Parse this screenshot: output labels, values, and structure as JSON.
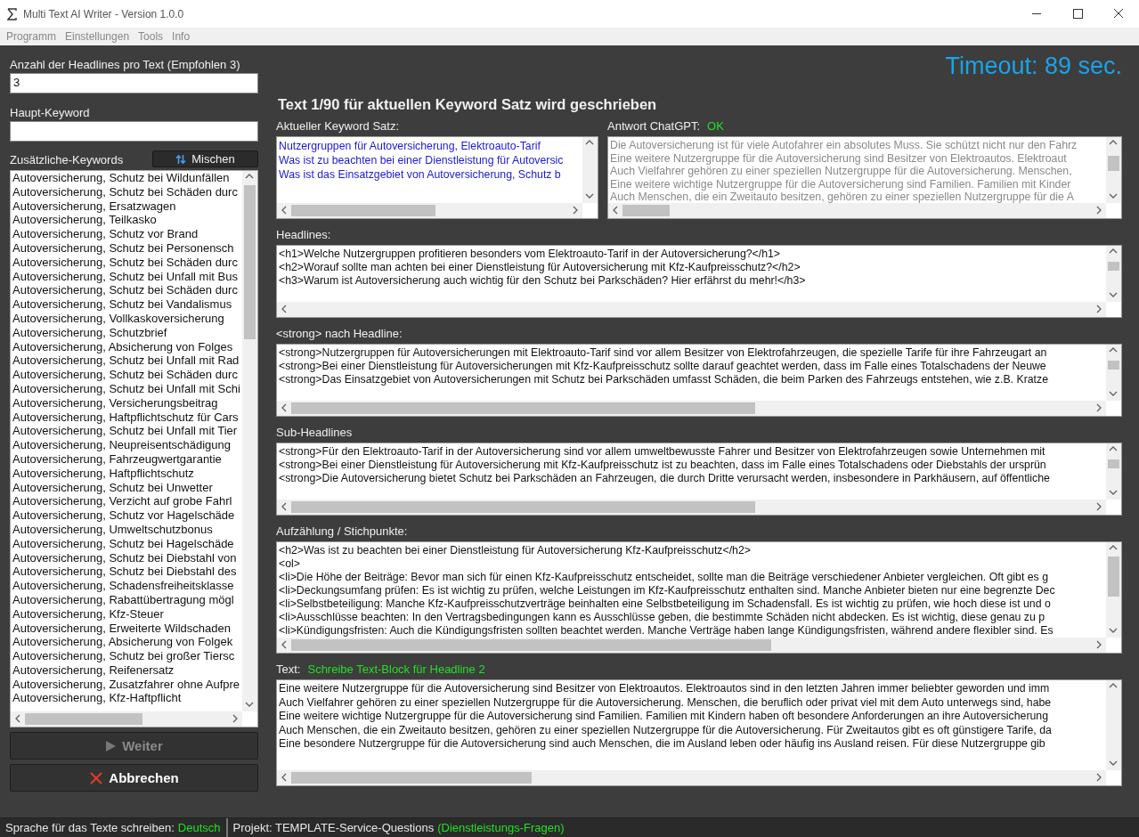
{
  "window": {
    "title": "Multi Text AI Writer - Version 1.0.0"
  },
  "menu": [
    "Programm",
    "Einstellungen",
    "Tools",
    "Info"
  ],
  "left": {
    "headline_count": {
      "label": "Anzahl der Headlines pro Text (Empfohlen 3)",
      "value": "3"
    },
    "main_keyword": {
      "label": "Haupt-Keyword"
    },
    "extra_keywords": {
      "label": "Zusätzliche-Keywords",
      "shuffle_button": "Mischen",
      "items": [
        "Autoversicherung, Schutz bei Wildunfällen",
        "Autoversicherung, Schutz bei Schäden durc",
        "Autoversicherung, Ersatzwagen",
        "Autoversicherung, Teilkasko",
        "Autoversicherung, Schutz vor Brand",
        "Autoversicherung, Schutz bei Personensch",
        "Autoversicherung, Schutz bei Schäden durc",
        "Autoversicherung, Schutz bei Unfall mit Bus",
        "Autoversicherung, Schutz bei Schäden durc",
        "Autoversicherung, Schutz bei Vandalismus",
        "Autoversicherung, Vollkaskoversicherung",
        "Autoversicherung, Schutzbrief",
        "Autoversicherung, Absicherung von Folges",
        "Autoversicherung, Schutz bei Unfall mit Rad",
        "Autoversicherung, Schutz bei Schäden durc",
        "Autoversicherung, Schutz bei Unfall mit Schi",
        "Autoversicherung, Versicherungsbeitrag",
        "Autoversicherung, Haftpflichtschutz für Cars",
        "Autoversicherung, Schutz bei Unfall mit Tier",
        "Autoversicherung, Neupreisentschädigung",
        "Autoversicherung, Fahrzeugwertgarantie",
        "Autoversicherung, Haftpflichtschutz",
        "Autoversicherung, Schutz bei Unwetter",
        "Autoversicherung, Verzicht auf grobe Fahrl",
        "Autoversicherung, Schutz vor Hagelschäde",
        "Autoversicherung, Umweltschutzbonus",
        "Autoversicherung, Schutz bei Hagelschäde",
        "Autoversicherung, Schutz bei Diebstahl von",
        "Autoversicherung, Schutz bei Diebstahl des",
        "Autoversicherung, Schadensfreiheitsklasse",
        "Autoversicherung, Rabattübertragung mögl",
        "Autoversicherung, Kfz-Steuer",
        "Autoversicherung, Erweiterte Wildschaden",
        "Autoversicherung, Absicherung von Folgek",
        "Autoversicherung, Schutz bei großer Tiersc",
        "Autoversicherung, Reifenersatz",
        "Autoversicherung, Zusatzfahrer ohne Aufpre",
        "Autoversicherung, Kfz-Haftpflicht"
      ]
    },
    "buttons": [
      {
        "label": "Weiter",
        "kind": "next",
        "disabled": true
      },
      {
        "label": "Abbrechen",
        "kind": "cancel",
        "disabled": false
      }
    ]
  },
  "right": {
    "timeout": "Timeout: 89 sec.",
    "heading": "Text 1/90 für aktuellen Keyword Satz wird geschrieben",
    "keyword_set": {
      "label": "Aktueller Keyword Satz:",
      "lines": [
        "Nutzergruppen für Autoversicherung, Elektroauto-Tarif",
        "Was ist zu beachten bei einer Dienstleistung für Autoversic",
        "Was ist das Einsatzgebiet von Autoversicherung, Schutz b"
      ]
    },
    "chatgpt": {
      "label": "Antwort ChatGPT:",
      "status": "OK",
      "lines": [
        "Die Autoversicherung ist für viele Autofahrer ein absolutes Muss. Sie schützt nicht nur den Fahrz",
        "Eine weitere Nutzergruppe für die Autoversicherung sind Besitzer von Elektroautos. Elektroaut",
        "Auch Vielfahrer gehören zu einer speziellen Nutzergruppe für die Autoversicherung. Menschen,",
        "Eine weitere wichtige Nutzergruppe für die Autoversicherung sind Familien. Familien mit Kinder",
        "Auch Menschen, die ein Zweitauto besitzen, gehören zu einer speziellen Nutzergruppe für die A"
      ]
    },
    "headlines": {
      "label": "Headlines:",
      "lines": [
        "<h1>Welche Nutzergruppen profitieren besonders vom Elektroauto-Tarif in der Autoversicherung?</h1>",
        "<h2>Worauf sollte man achten bei einer Dienstleistung für Autoversicherung mit Kfz-Kaufpreisschutz?</h2>",
        "<h3>Warum ist Autoversicherung auch wichtig für den Schutz bei Parkschäden? Hier erfährst du mehr!</h3>"
      ]
    },
    "strong": {
      "label": "<strong> nach Headline:",
      "lines": [
        "<strong>Nutzergruppen für Autoversicherungen mit Elektroauto-Tarif sind vor allem Besitzer von Elektrofahrzeugen, die spezielle Tarife für ihre Fahrzeugart an",
        "<strong>Bei einer Dienstleistung für Autoversicherungen mit Kfz-Kaufpreisschutz sollte darauf geachtet werden, dass im Falle eines Totalschadens der Neuwe",
        "<strong>Das Einsatzgebiet von Autoversicherungen mit Schutz bei Parkschäden umfasst Schäden, die beim Parken des Fahrzeugs entstehen, wie z.B. Kratze"
      ]
    },
    "sub_headlines": {
      "label": "Sub-Headlines",
      "lines": [
        "<strong>Für den Elektroauto-Tarif in der Autoversicherung sind vor allem umweltbewusste Fahrer und Besitzer von Elektrofahrzeugen sowie Unternehmen mit",
        "<strong>Bei einer Dienstleistung für Autoversicherung mit Kfz-Kaufpreisschutz ist zu beachten, dass im Falle eines Totalschadens oder Diebstahls der ursprün",
        "<strong>Die Autoversicherung bietet Schutz bei Parkschäden an Fahrzeugen, die durch Dritte verursacht werden, insbesondere in Parkhäusern, auf öffentliche"
      ]
    },
    "bullets": {
      "label": "Aufzählung / Stichpunkte:",
      "lines": [
        "<h2>Was ist zu beachten bei einer Dienstleistung für Autoversicherung Kfz-Kaufpreisschutz</h2>",
        "<ol>",
        "<li>Die Höhe der Beiträge: Bevor man sich für einen Kfz-Kaufpreisschutz entscheidet, sollte man die Beiträge verschiedener Anbieter vergleichen. Oft gibt es g",
        "<li>Deckungsumfang prüfen: Es ist wichtig zu prüfen, welche Leistungen im Kfz-Kaufpreisschutz enthalten sind. Manche Anbieter bieten nur eine begrenzte Dec",
        "<li>Selbstbeteiligung: Manche Kfz-Kaufpreisschutzverträge beinhalten eine Selbstbeteiligung im Schadensfall. Es ist wichtig zu prüfen, wie hoch diese ist und o",
        "<li>Ausschlüsse beachten: In den Vertragsbedingungen kann es Ausschlüsse geben, die bestimmte Schäden nicht abdecken. Es ist wichtig, diese genau zu p",
        "<li>Kündigungsfristen: Auch die Kündigungsfristen sollten beachtet werden. Manche Verträge haben lange Kündigungsfristen, während andere flexibler sind. Es"
      ]
    },
    "text": {
      "label": "Text:",
      "status": "Schreibe Text-Block für Headline 2",
      "lines": [
        "Eine weitere Nutzergruppe für die Autoversicherung sind Besitzer von Elektroautos. Elektroautos sind in den letzten Jahren immer beliebter geworden und imm",
        "Auch Vielfahrer gehören zu einer speziellen Nutzergruppe für die Autoversicherung. Menschen, die beruflich oder privat viel mit dem Auto unterwegs sind, habe",
        "Eine weitere wichtige Nutzergruppe für die Autoversicherung sind Familien. Familien mit Kindern haben oft besondere Anforderungen an ihre Autoversicherung",
        "Auch Menschen, die ein Zweitauto besitzen, gehören zu einer speziellen Nutzergruppe für die Autoversicherung. Für Zweitautos gibt es oft günstigere Tarife, da",
        "Eine besondere Nutzergruppe für die Autoversicherung sind auch Menschen, die im Ausland leben oder häufig ins Ausland reisen. Für diese Nutzergruppe gib"
      ]
    }
  },
  "status_bar": [
    {
      "label": "Sprache für das Texte schreiben:",
      "value": "Deutsch"
    },
    {
      "label": "Projekt: TEMPLATE-Service-Questions",
      "value": "(Dienstleistungs-Fragen)"
    }
  ]
}
